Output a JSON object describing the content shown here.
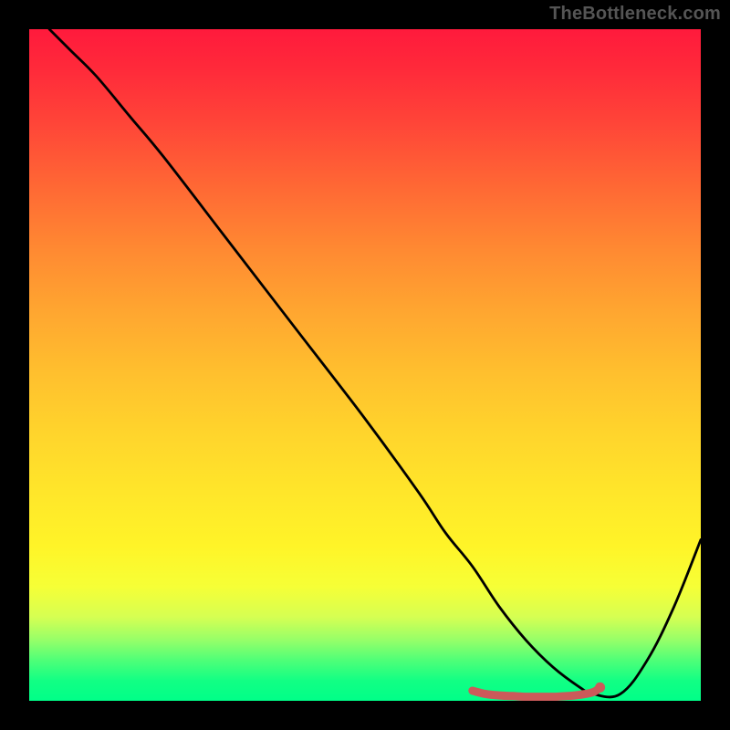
{
  "watermark": "TheBottleneck.com",
  "chart_data": {
    "type": "line",
    "title": "",
    "xlabel": "",
    "ylabel": "",
    "xlim": [
      0,
      100
    ],
    "ylim": [
      0,
      100
    ],
    "grid": false,
    "series": [
      {
        "name": "curve",
        "color": "#000000",
        "x": [
          3,
          6,
          10,
          15,
          20,
          30,
          40,
          50,
          58,
          62,
          66,
          70,
          74,
          78,
          82,
          84,
          88,
          92,
          96,
          100
        ],
        "y": [
          100,
          97,
          93,
          87,
          81,
          68,
          55,
          42,
          31,
          25,
          20,
          14,
          9,
          5,
          2,
          1,
          1,
          6,
          14,
          24
        ]
      },
      {
        "name": "marker-band",
        "color": "#cc5a5a",
        "x": [
          66,
          68,
          70,
          72,
          74,
          76,
          78,
          80,
          82,
          84,
          85
        ],
        "y": [
          1.5,
          1.0,
          0.8,
          0.7,
          0.6,
          0.6,
          0.6,
          0.7,
          0.9,
          1.3,
          2.0
        ]
      }
    ],
    "gradient_stops": [
      {
        "pos": 0,
        "color": "#ff1a3c"
      },
      {
        "pos": 50,
        "color": "#ffbf2e"
      },
      {
        "pos": 80,
        "color": "#fff428"
      },
      {
        "pos": 100,
        "color": "#00ff88"
      }
    ]
  }
}
